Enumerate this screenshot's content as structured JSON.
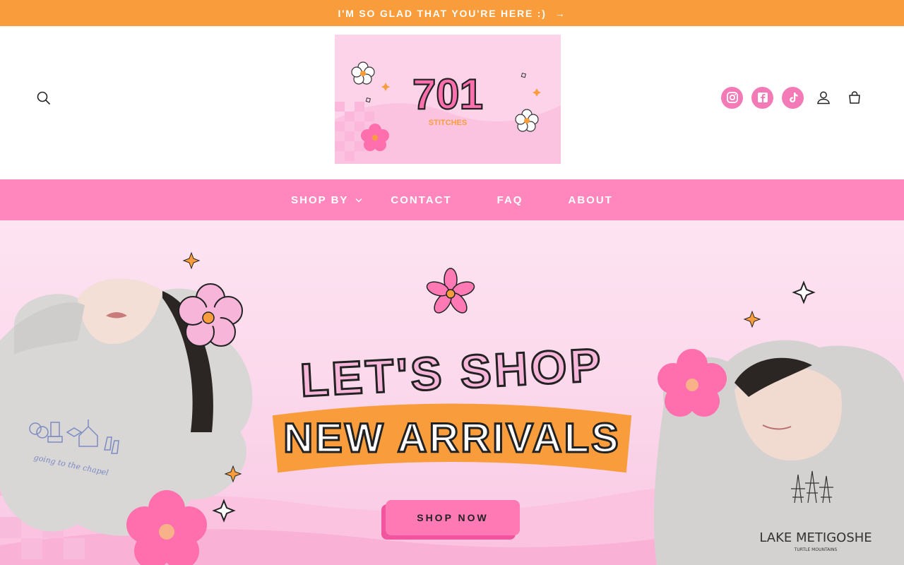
{
  "announcement": {
    "text": "I'M SO GLAD THAT YOU'RE HERE :)",
    "arrow": "→"
  },
  "header": {
    "logo": {
      "number": "701",
      "subtitle": "STITCHES"
    },
    "icons": [
      "search-icon",
      "instagram-icon",
      "facebook-icon",
      "tiktok-icon",
      "account-icon",
      "cart-icon"
    ]
  },
  "nav": {
    "items": [
      {
        "label": "SHOP BY",
        "has_dropdown": true
      },
      {
        "label": "CONTACT"
      },
      {
        "label": "FAQ"
      },
      {
        "label": "ABOUT"
      }
    ]
  },
  "hero": {
    "headline_1": "LET'S SHOP",
    "headline_2": "NEW ARRIVALS",
    "cta": "SHOP NOW",
    "left_photo_text": "going to the chapel",
    "right_photo_text": "LAKE METIGOSHE",
    "right_photo_subtext": "TURTLE MOUNTAINS"
  },
  "colors": {
    "announcement_bg": "#f99d3c",
    "nav_bg": "#ff87bd",
    "social_bg": "#f47ab7",
    "hero_bg": "#fde4f2",
    "accent_orange": "#f99d3c",
    "accent_pink": "#ff7ab5"
  }
}
